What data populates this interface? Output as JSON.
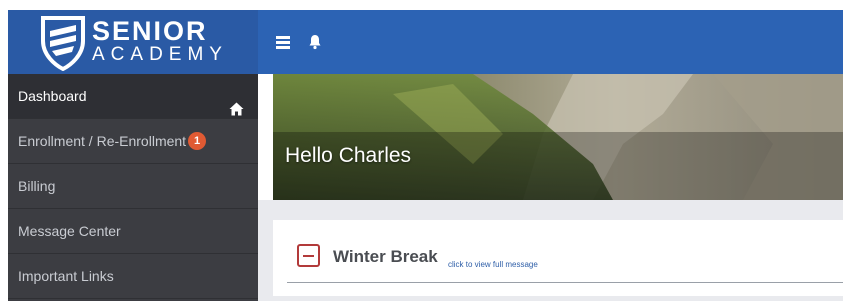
{
  "brand": {
    "line1": "SENIOR",
    "line2": "ACADEMY"
  },
  "header": {
    "menu_icon": "hamburger-icon",
    "bell_icon": "bell-icon"
  },
  "sidebar": {
    "items": [
      {
        "label": "Dashboard",
        "icon": "home-icon"
      },
      {
        "label": "Enrollment / Re-Enrollment",
        "badge": "1"
      },
      {
        "label": "Billing"
      },
      {
        "label": "Message Center"
      },
      {
        "label": "Important Links"
      }
    ]
  },
  "hero": {
    "greeting": "Hello Charles"
  },
  "message": {
    "title": "Winter Break",
    "link": "click to view full message"
  },
  "colors": {
    "header": "#2c63b4",
    "sidebar": "#3c3d42",
    "badge": "#e05a33",
    "collapse": "#b23a3a"
  }
}
